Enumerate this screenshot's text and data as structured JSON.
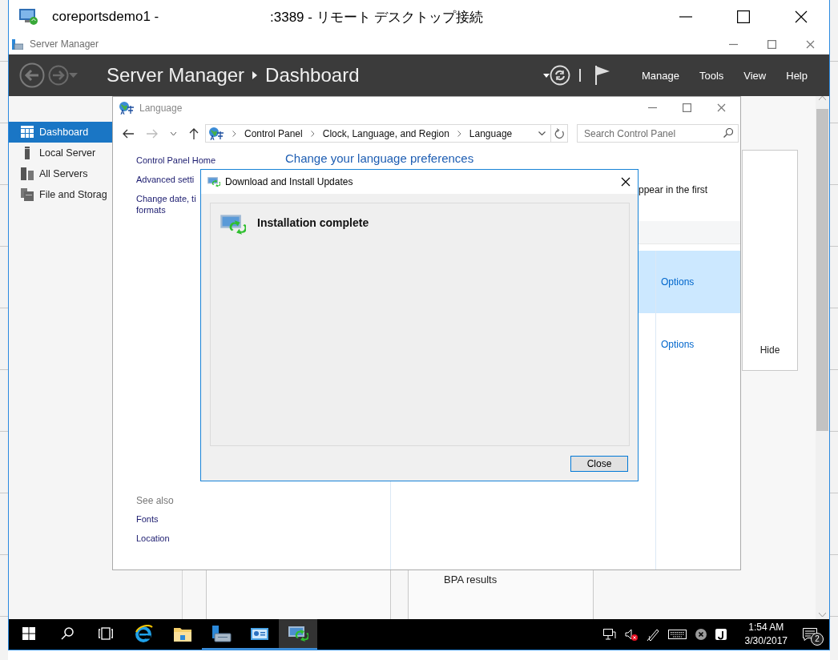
{
  "remote_desktop": {
    "title_host": "coreportsdemo1 -",
    "title_suffix": ":3389 - リモート デスクトップ接続"
  },
  "server_manager": {
    "title": "Server Manager",
    "breadcrumb": [
      "Server Manager",
      "Dashboard"
    ],
    "menu": [
      "Manage",
      "Tools",
      "View",
      "Help"
    ],
    "sidebar": {
      "items": [
        {
          "label": "Dashboard",
          "kind": "dashboard",
          "selected": true
        },
        {
          "label": "Local Server",
          "kind": "server",
          "selected": false
        },
        {
          "label": "All Servers",
          "kind": "servers",
          "selected": false
        },
        {
          "label": "File and Storag",
          "kind": "storage",
          "selected": false
        }
      ]
    },
    "tiles": [
      {
        "kind": "hide-tile",
        "label": "Hide"
      },
      {
        "kind": "blank-tile"
      },
      {
        "kind": "bpa-tile",
        "label": "BPA results"
      }
    ]
  },
  "language_window": {
    "title": "Language",
    "address": [
      "Control Panel",
      "Clock, Language, and Region",
      "Language"
    ],
    "search": {
      "placeholder": "Search Control Panel"
    },
    "tasks": [
      "Control Panel Home",
      "Advanced setti",
      "Change date, ti\nformats"
    ],
    "see_also": {
      "heading": "See also",
      "links": [
        "Fonts",
        "Location"
      ]
    },
    "heading": "Change your language preferences",
    "description": "ppear in the first",
    "languages": [
      {
        "action": "Options",
        "selected": true
      },
      {
        "action": "Options",
        "selected": false
      }
    ]
  },
  "dialog": {
    "title": "Download and Install Updates",
    "message": "Installation complete",
    "button": "Close"
  },
  "taskbar": {
    "apps": [
      {
        "kind": "start",
        "running": false,
        "selected": false
      },
      {
        "kind": "search",
        "running": false,
        "selected": false
      },
      {
        "kind": "task-view",
        "running": false,
        "selected": false
      },
      {
        "kind": "browser",
        "running": false,
        "selected": false
      },
      {
        "kind": "folder",
        "running": false,
        "selected": false
      },
      {
        "kind": "server-manager",
        "running": true,
        "selected": false
      },
      {
        "kind": "control-panel",
        "running": true,
        "selected": false
      },
      {
        "kind": "updates",
        "running": true,
        "selected": true
      }
    ],
    "tray": [
      {
        "kind": "network"
      },
      {
        "kind": "volume-muted"
      },
      {
        "kind": "pen"
      },
      {
        "kind": "keyboard"
      },
      {
        "kind": "ime-off"
      },
      {
        "kind": "ime"
      }
    ],
    "clock": {
      "time": "1:54 AM",
      "date": "3/30/2017"
    },
    "notifications": {
      "count": "2"
    }
  }
}
